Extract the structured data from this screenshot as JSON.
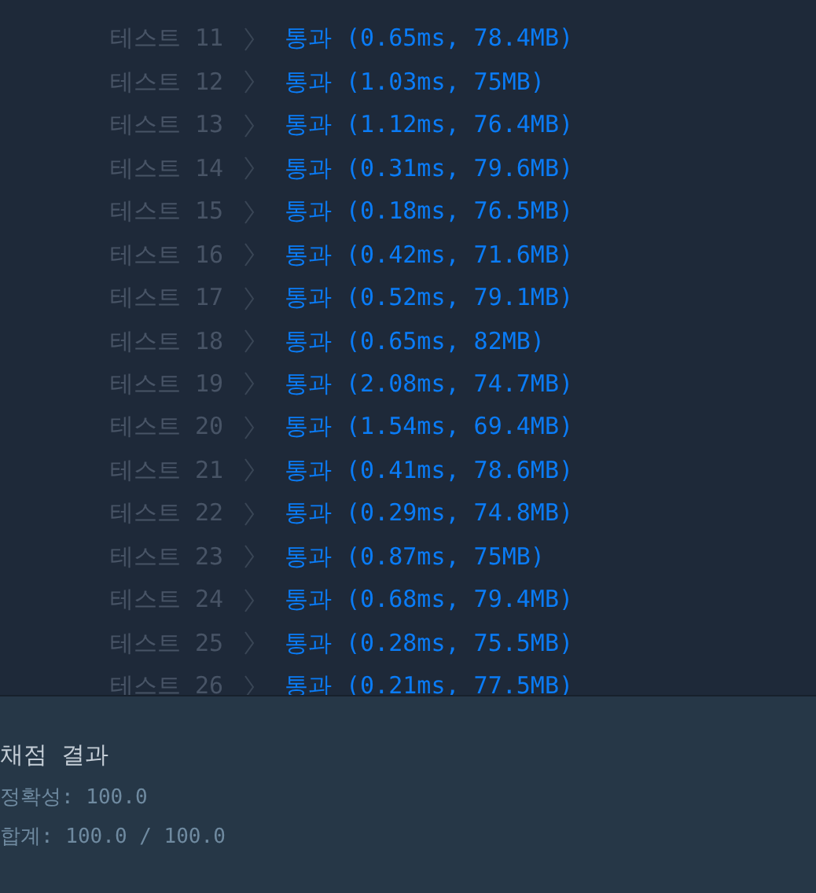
{
  "tests": [
    {
      "label": "테스트 11",
      "result": "통과 (0.65ms, 78.4MB)"
    },
    {
      "label": "테스트 12",
      "result": "통과 (1.03ms, 75MB)"
    },
    {
      "label": "테스트 13",
      "result": "통과 (1.12ms, 76.4MB)"
    },
    {
      "label": "테스트 14",
      "result": "통과 (0.31ms, 79.6MB)"
    },
    {
      "label": "테스트 15",
      "result": "통과 (0.18ms, 76.5MB)"
    },
    {
      "label": "테스트 16",
      "result": "통과 (0.42ms, 71.6MB)"
    },
    {
      "label": "테스트 17",
      "result": "통과 (0.52ms, 79.1MB)"
    },
    {
      "label": "테스트 18",
      "result": "통과 (0.65ms, 82MB)"
    },
    {
      "label": "테스트 19",
      "result": "통과 (2.08ms, 74.7MB)"
    },
    {
      "label": "테스트 20",
      "result": "통과 (1.54ms, 69.4MB)"
    },
    {
      "label": "테스트 21",
      "result": "통과 (0.41ms, 78.6MB)"
    },
    {
      "label": "테스트 22",
      "result": "통과 (0.29ms, 74.8MB)"
    },
    {
      "label": "테스트 23",
      "result": "통과 (0.87ms, 75MB)"
    },
    {
      "label": "테스트 24",
      "result": "통과 (0.68ms, 79.4MB)"
    },
    {
      "label": "테스트 25",
      "result": "통과 (0.28ms, 75.5MB)"
    },
    {
      "label": "테스트 26",
      "result": "통과 (0.21ms, 77.5MB)"
    }
  ],
  "grading": {
    "title": "채점 결과",
    "accuracy": "정확성: 100.0",
    "total": "합계: 100.0 / 100.0"
  }
}
